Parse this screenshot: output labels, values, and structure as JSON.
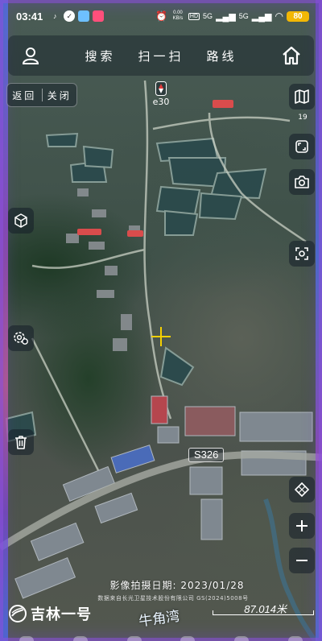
{
  "status_bar": {
    "time": "03:41",
    "network_speed": "0.00 KB/s",
    "signal_1": "5G",
    "signal_2": "5G",
    "battery": "80"
  },
  "topnav": {
    "search_label": "搜索",
    "scan_label": "扫一扫",
    "route_label": "路线"
  },
  "backclose": {
    "back_label": "返回",
    "close_label": "关闭"
  },
  "compass": {
    "heading_label": "e30"
  },
  "tools": {
    "layer_count": "19"
  },
  "map": {
    "road_label": "S326",
    "place_label": "牛角湾",
    "capture_date": "影像拍摄日期: 2023/01/28",
    "source_note": "数据来自长光卫星技术股份有限公司 GS(2024)5008号",
    "scale_text": "87.014米"
  },
  "brand": {
    "name": "吉林一号"
  },
  "colors": {
    "battery": "#f2b705",
    "crosshair": "#f5d000",
    "frame_accent": "#a24bd8"
  }
}
